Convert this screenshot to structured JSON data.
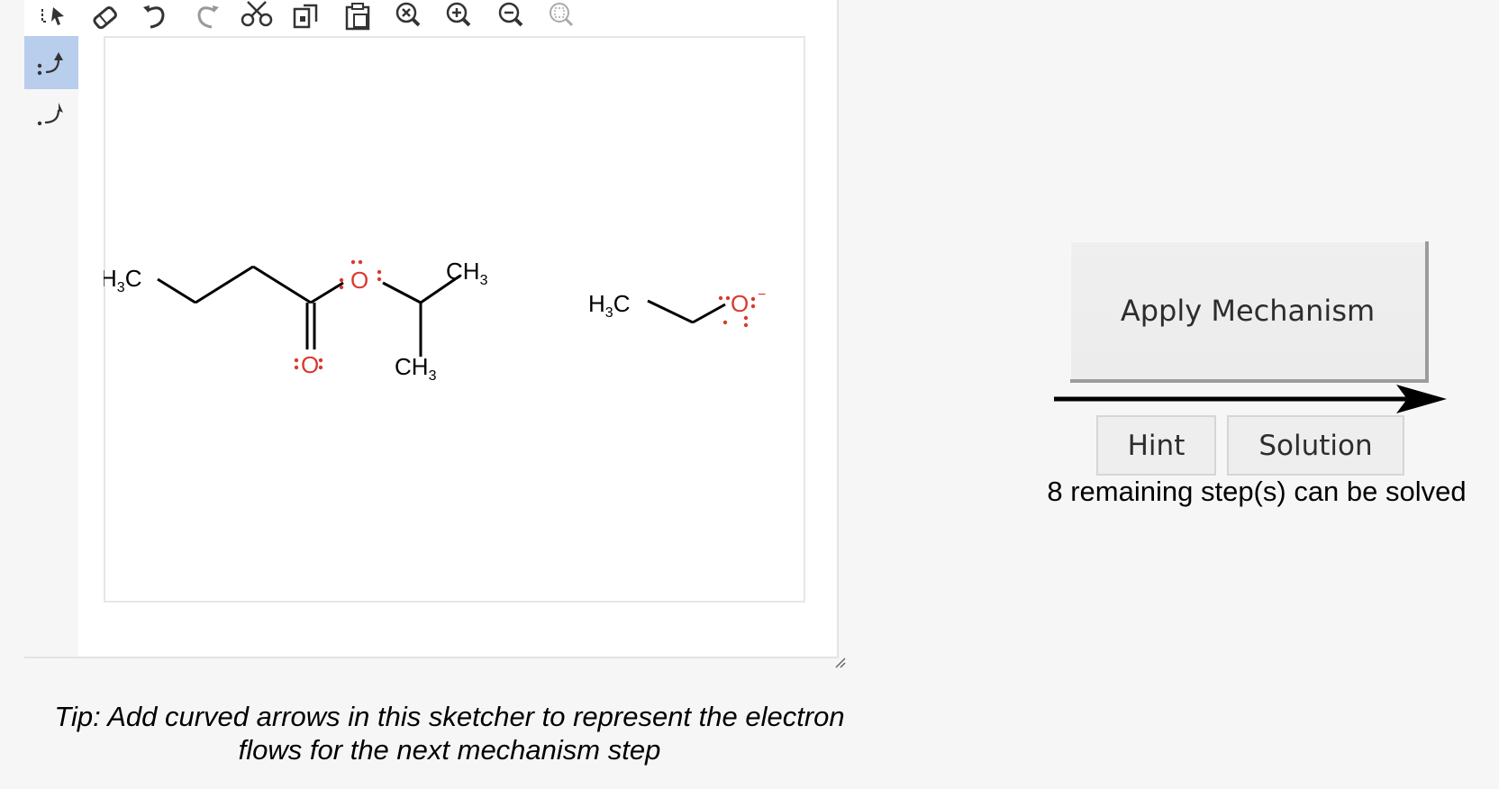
{
  "toolbar": {
    "icons": [
      "select-icon",
      "erase-icon",
      "undo-icon",
      "redo-icon",
      "cut-icon",
      "copy-icon",
      "paste-icon",
      "zoom-reset-icon",
      "zoom-in-icon",
      "zoom-out-icon",
      "zoom-fit-icon"
    ]
  },
  "left_tools": [
    {
      "icon": "electron-pair-arrow-icon",
      "active": true
    },
    {
      "icon": "single-electron-arrow-icon",
      "active": false
    }
  ],
  "molecule1": {
    "left_group": "H3C",
    "right_group": "CH3",
    "bottom_group": "CH3",
    "ester_oxygen": "O",
    "carbonyl_oxygen": "O"
  },
  "molecule2": {
    "left_group": "H3C",
    "oxygen": "O",
    "charge": "−"
  },
  "colors": {
    "oxygen": "#d83a2e",
    "bond": "#000000",
    "active_tool": "#b9cdec"
  },
  "tip": {
    "line1": "Tip: Add curved arrows in this sketcher to represent the electron",
    "line2": "flows for the next mechanism step"
  },
  "controls": {
    "apply_label": "Apply Mechanism",
    "hint_label": "Hint",
    "solution_label": "Solution",
    "remaining_text": "8 remaining step(s) can be solved"
  }
}
